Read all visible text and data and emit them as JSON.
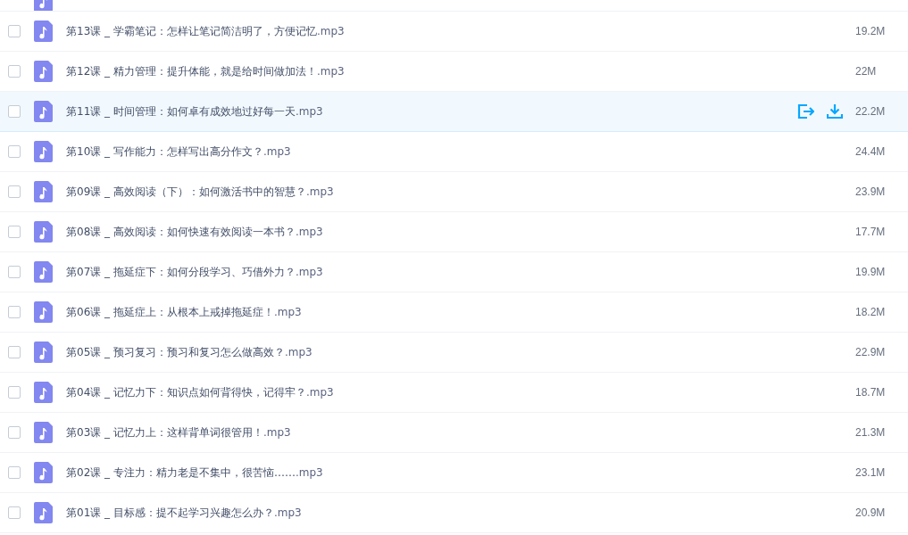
{
  "files": [
    {
      "name": "第13课 _ 学霸笔记：怎样让笔记简洁明了，方便记忆",
      "ext": ".mp3",
      "size": "19.2M",
      "hovered": false,
      "checked": false
    },
    {
      "name": "第12课 _ 精力管理：提升体能，就是给时间做加法！",
      "ext": ".mp3",
      "size": "22M",
      "hovered": false,
      "checked": false
    },
    {
      "name": "第11课 _ 时间管理：如何卓有成效地过好每一天",
      "ext": ".mp3",
      "size": "22.2M",
      "hovered": true,
      "checked": false
    },
    {
      "name": "第10课 _ 写作能力：怎样写出高分作文？",
      "ext": ".mp3",
      "size": "24.4M",
      "hovered": false,
      "checked": false
    },
    {
      "name": "第09课 _ 高效阅读（下）：如何激活书中的智慧？",
      "ext": ".mp3",
      "size": "23.9M",
      "hovered": false,
      "checked": false
    },
    {
      "name": "第08课 _ 高效阅读：如何快速有效阅读一本书？",
      "ext": ".mp3",
      "size": "17.7M",
      "hovered": false,
      "checked": false
    },
    {
      "name": "第07课 _ 拖延症下：如何分段学习、巧借外力？",
      "ext": ".mp3",
      "size": "19.9M",
      "hovered": false,
      "checked": false
    },
    {
      "name": "第06课 _ 拖延症上：从根本上戒掉拖延症！",
      "ext": ".mp3",
      "size": "18.2M",
      "hovered": false,
      "checked": false
    },
    {
      "name": "第05课 _ 预习复习：预习和复习怎么做高效？",
      "ext": ".mp3",
      "size": "22.9M",
      "hovered": false,
      "checked": false
    },
    {
      "name": "第04课 _ 记忆力下：知识点如何背得快，记得牢？",
      "ext": ".mp3",
      "size": "18.7M",
      "hovered": false,
      "checked": false
    },
    {
      "name": "第03课 _ 记忆力上：这样背单词很管用！",
      "ext": ".mp3",
      "size": "21.3M",
      "hovered": false,
      "checked": false
    },
    {
      "name": "第02课 _ 专注力：精力老是不集中，很苦恼……",
      "ext": ".mp3",
      "size": "23.1M",
      "hovered": false,
      "checked": false
    },
    {
      "name": "第01课 _ 目标感：提不起学习兴趣怎么办？",
      "ext": ".mp3",
      "size": "20.9M",
      "hovered": false,
      "checked": false
    }
  ]
}
